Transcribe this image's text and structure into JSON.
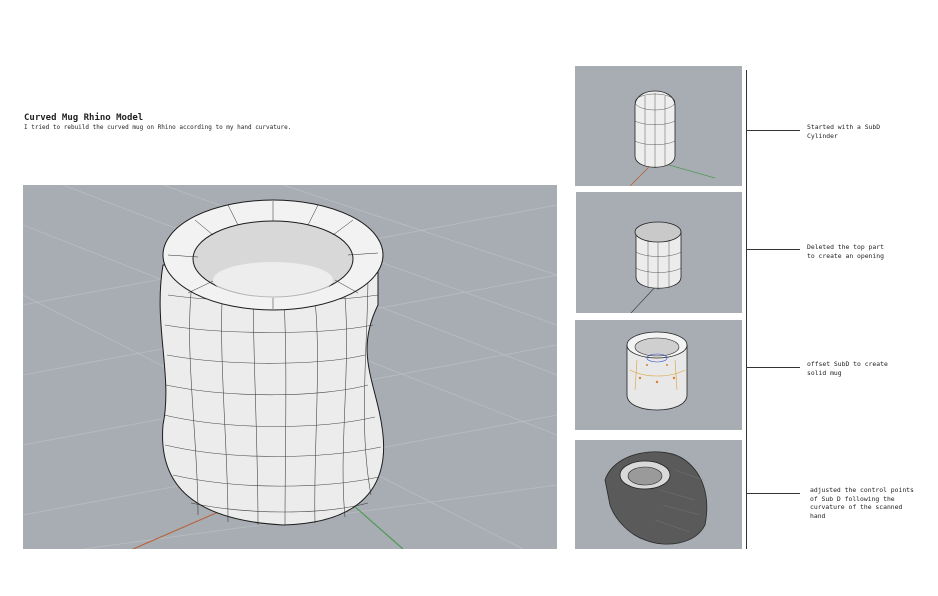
{
  "header": {
    "title": "Curved Mug Rhino Model",
    "subtitle": "I tried to rebuild the curved mug on Rhino according to my hand curvature."
  },
  "steps": [
    {
      "label": "Started with a SubD\nCylinder"
    },
    {
      "label": "Deleted the top part\nto create an opening"
    },
    {
      "label": "offset SubD to create\nsolid mug"
    },
    {
      "label": "adjusted the control points\nof Sub D following the\ncurvature of the scanned\nhand"
    }
  ],
  "colors": {
    "viewport_bg": "#a8adb3",
    "grid": "#b9bdc2",
    "x_axis": "#b5653f",
    "y_axis": "#4f9a56",
    "mesh_line": "#1c1c1c"
  },
  "icons": {
    "main": "curved-mug-model",
    "step1": "subd-cylinder",
    "step2": "open-cylinder",
    "step3": "offset-mug",
    "step4": "scanned-hand-mug"
  }
}
